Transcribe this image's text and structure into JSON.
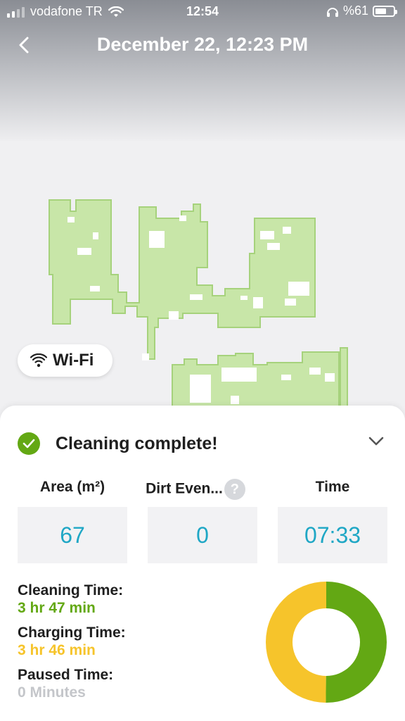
{
  "status_bar": {
    "carrier": "vodafone TR",
    "time": "12:54",
    "battery": "%61",
    "battery_level": 0.61
  },
  "nav": {
    "title": "December 22, 12:23 PM",
    "back_icon": "chevron-left-icon"
  },
  "wifi_chip": {
    "label": "Wi-Fi",
    "icon": "wifi-icon"
  },
  "summary": {
    "status": "Cleaning complete!",
    "stats": [
      {
        "label": "Area (m²)",
        "value": "67"
      },
      {
        "label": "Dirt Even...",
        "value": "0"
      },
      {
        "label": "Time",
        "value": "07:33"
      }
    ],
    "times": [
      {
        "label": "Cleaning Time:",
        "value": "3 hr 47 min",
        "color": "#63a814"
      },
      {
        "label": "Charging Time:",
        "value": "3 hr 46 min",
        "color": "#f6c42b"
      },
      {
        "label": "Paused Time:",
        "value": "0 Minutes",
        "color": "#c4c6ca"
      }
    ],
    "donut": {
      "segments": [
        {
          "name": "Cleaning Time",
          "value": 227,
          "color": "#63a814"
        },
        {
          "name": "Charging Time",
          "value": 226,
          "color": "#f6c42b"
        },
        {
          "name": "Paused Time",
          "value": 0,
          "color": "#c4c6ca"
        }
      ]
    }
  },
  "colors": {
    "accent_value": "#1fa7c5",
    "map_fill": "#c8e6a8",
    "map_stroke": "#a6d27c"
  }
}
